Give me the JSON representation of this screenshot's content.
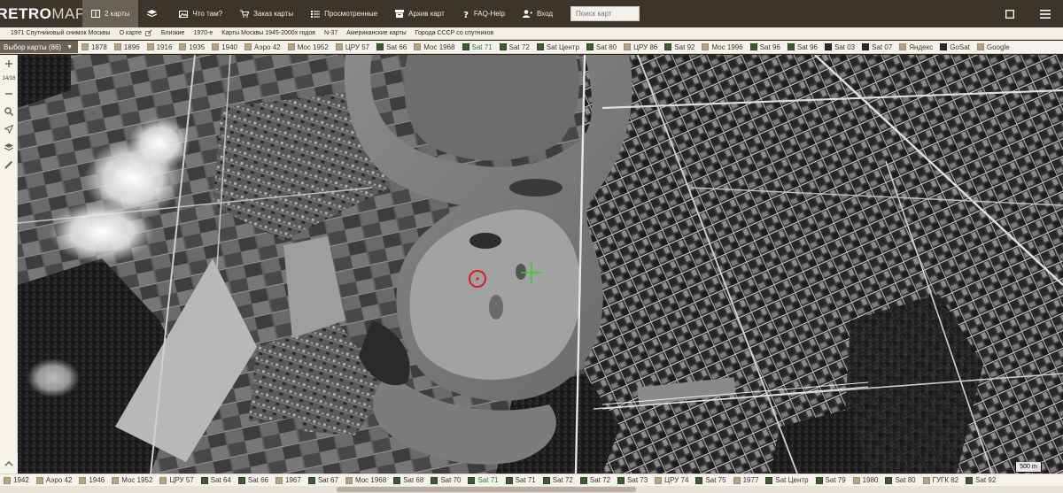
{
  "header": {
    "logo_bold": "RETRO",
    "logo_light": "MAP",
    "nav": [
      {
        "label": "2 карты",
        "icon": "two-maps-icon",
        "active": true
      },
      {
        "label": "",
        "icon": "layers-icon",
        "active": false
      },
      {
        "label": "Что там?",
        "icon": "image-icon",
        "active": false
      },
      {
        "label": "Заказ карты",
        "icon": "cart-icon",
        "active": false
      },
      {
        "label": "Просмотренные",
        "icon": "list-icon",
        "active": false
      },
      {
        "label": "Архив карт",
        "icon": "archive-icon",
        "active": false
      },
      {
        "label": "FAQ-Help",
        "icon": "help-icon",
        "active": false
      },
      {
        "label": "Вход",
        "icon": "user-icon",
        "active": false
      }
    ],
    "search_placeholder": "Поиск карт"
  },
  "infobar": {
    "items": [
      "1971 Спутниковый снимок Москвы",
      "О карте",
      "Близкие",
      "1970-е",
      "Карты Москвы 1945-2000х годов",
      "N-37",
      "Американские карты",
      "Города СССР со спутников"
    ]
  },
  "top_tiles": {
    "selector_label": "Выбор карты (86)",
    "items": [
      {
        "label": "1878",
        "kind": "old"
      },
      {
        "label": "1896",
        "kind": "old"
      },
      {
        "label": "1916",
        "kind": "old"
      },
      {
        "label": "1935",
        "kind": "old"
      },
      {
        "label": "1940",
        "kind": "old"
      },
      {
        "label": "Аэро 42",
        "kind": "old"
      },
      {
        "label": "Мос 1952",
        "kind": "old"
      },
      {
        "label": "ЦРУ 57",
        "kind": "old"
      },
      {
        "label": "Sat 66",
        "kind": "sat"
      },
      {
        "label": "Мос 1968",
        "kind": "old"
      },
      {
        "label": "Sat 71",
        "kind": "sat",
        "active": true
      },
      {
        "label": "Sat 72",
        "kind": "sat"
      },
      {
        "label": "Sat Центр",
        "kind": "sat"
      },
      {
        "label": "Sat 80",
        "kind": "sat"
      },
      {
        "label": "ЦРУ 86",
        "kind": "old"
      },
      {
        "label": "Sat 92",
        "kind": "sat"
      },
      {
        "label": "Мос 1996",
        "kind": "old"
      },
      {
        "label": "Sat 96",
        "kind": "sat"
      },
      {
        "label": "Sat 96",
        "kind": "sat"
      },
      {
        "label": "Sat 03",
        "kind": "dark"
      },
      {
        "label": "Sat 07",
        "kind": "dark"
      },
      {
        "label": "Яндекс",
        "kind": "old"
      },
      {
        "label": "GoSat",
        "kind": "dark"
      },
      {
        "label": "Google",
        "kind": "old"
      }
    ]
  },
  "bottom_tiles": {
    "items": [
      {
        "label": "1942",
        "kind": "old"
      },
      {
        "label": "Аэро 42",
        "kind": "old"
      },
      {
        "label": "1946",
        "kind": "old"
      },
      {
        "label": "Мос 1952",
        "kind": "old"
      },
      {
        "label": "ЦРУ 57",
        "kind": "old"
      },
      {
        "label": "Sat 64",
        "kind": "sat"
      },
      {
        "label": "Sat 66",
        "kind": "sat"
      },
      {
        "label": "1967",
        "kind": "old"
      },
      {
        "label": "Sat 67",
        "kind": "sat"
      },
      {
        "label": "Мос 1968",
        "kind": "old"
      },
      {
        "label": "Sat 68",
        "kind": "sat"
      },
      {
        "label": "Sat 70",
        "kind": "sat"
      },
      {
        "label": "Sat 71",
        "kind": "sat",
        "active": true
      },
      {
        "label": "Sat 71",
        "kind": "sat"
      },
      {
        "label": "Sat 72",
        "kind": "sat"
      },
      {
        "label": "Sat 72",
        "kind": "sat"
      },
      {
        "label": "Sat 73",
        "kind": "sat"
      },
      {
        "label": "ЦРУ 74",
        "kind": "old"
      },
      {
        "label": "Sat 75",
        "kind": "sat"
      },
      {
        "label": "1977",
        "kind": "old"
      },
      {
        "label": "Sat Центр",
        "kind": "sat"
      },
      {
        "label": "Sat 79",
        "kind": "sat"
      },
      {
        "label": "1980",
        "kind": "old"
      },
      {
        "label": "Sat 80",
        "kind": "sat"
      },
      {
        "label": "ГУГК 82",
        "kind": "old"
      },
      {
        "label": "Sat 92",
        "kind": "sat"
      }
    ]
  },
  "tools": {
    "zoom_level": "14/16"
  },
  "scale": "500 m",
  "colors": {
    "header_bg": "#3d342a",
    "active_nav": "#6b6155",
    "active_tile_text": "#2b7a3a",
    "marker_circle": "#e01b24",
    "marker_cross": "#2fd12f"
  }
}
